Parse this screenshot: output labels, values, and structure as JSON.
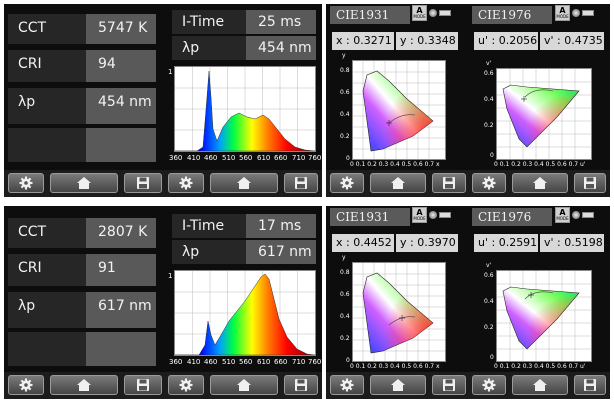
{
  "measurements": [
    {
      "cct_label": "CCT",
      "cct_value": "5747 K",
      "cri_label": "CRI",
      "cri_value": "94",
      "lp_label": "λp",
      "lp_value": "454 nm",
      "itime_label": "I-Time",
      "itime_value": "25 ms",
      "lp2_label": "λp",
      "lp2_value": "454 nm",
      "spectrum_y_label": "1",
      "spectrum_x_ticks": [
        "360",
        "410",
        "460",
        "510",
        "560",
        "610",
        "660",
        "710",
        "760"
      ],
      "cie1931_title": "CIE1931",
      "x_readout": "x : 0.3271",
      "y_readout": "y : 0.3348",
      "cie1976_title": "CIE1976",
      "u_readout": "u' : 0.2056",
      "v_readout": "v' : 0.4735",
      "mode_letter": "A",
      "mode_word": "MODE"
    },
    {
      "cct_label": "CCT",
      "cct_value": "2807 K",
      "cri_label": "CRI",
      "cri_value": "91",
      "lp_label": "λp",
      "lp_value": "617 nm",
      "itime_label": "I-Time",
      "itime_value": "17 ms",
      "lp2_label": "λp",
      "lp2_value": "617 nm",
      "spectrum_y_label": "1",
      "spectrum_x_ticks": [
        "360",
        "410",
        "460",
        "510",
        "560",
        "610",
        "660",
        "710",
        "760"
      ],
      "cie1931_title": "CIE1931",
      "x_readout": "x : 0.4452",
      "y_readout": "y : 0.3970",
      "cie1976_title": "CIE1976",
      "u_readout": "u' : 0.2591",
      "v_readout": "v' : 0.5198",
      "mode_letter": "A",
      "mode_word": "MODE"
    }
  ],
  "cie1931_axis": {
    "y_ticks": [
      "0.9",
      "0.8",
      "0.7",
      "0.6",
      "0.5",
      "0.4",
      "0.3",
      "0.2",
      "0.1",
      "0"
    ],
    "x_ticks": [
      "0",
      "0.1",
      "0.2",
      "0.3",
      "0.4",
      "0.5",
      "0.6",
      "0.7",
      "0.8"
    ],
    "y_letter": "y",
    "x_letter": "x"
  },
  "cie1976_axis": {
    "y_ticks": [
      "0.6",
      "0.5",
      "0.4",
      "0.3",
      "0.2",
      "0.1",
      "0"
    ],
    "x_ticks": [
      "0",
      "0.1",
      "0.2",
      "0.3",
      "0.4",
      "0.5",
      "0.6",
      "0.7"
    ],
    "y_letter": "v'",
    "x_letter": "u'"
  },
  "icons": [
    "gear-icon",
    "home-icon",
    "save-icon"
  ],
  "colors": {
    "panel": "#0d0d0d",
    "value_box": "#595959",
    "label_box": "#262626",
    "readout_box": "#d8d8d8"
  }
}
